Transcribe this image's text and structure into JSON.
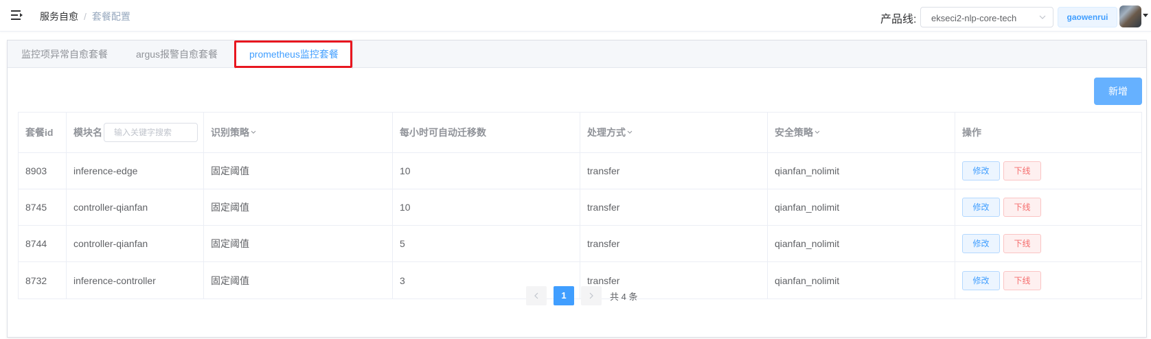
{
  "header": {
    "breadcrumb": {
      "home": "服务自愈",
      "separator": "/",
      "current": "套餐配置"
    },
    "product_line_label": "产品线:",
    "product_line_value": "ekseci2-nlp-core-tech",
    "username": "gaowenrui"
  },
  "tabs": [
    {
      "label": "监控项异常自愈套餐",
      "active": false
    },
    {
      "label": "argus报警自愈套餐",
      "active": false
    },
    {
      "label": "prometheus监控套餐",
      "active": true
    }
  ],
  "add_button": "新增",
  "table": {
    "columns": [
      "套餐id",
      "模块名",
      "识别策略",
      "每小时可自动迁移数",
      "处理方式",
      "安全策略",
      "操作"
    ],
    "module_search_placeholder": "输入关键字搜索",
    "rows": [
      {
        "id": "8903",
        "module": "inference-edge",
        "strategy": "固定阈值",
        "migrations": "10",
        "handling": "transfer",
        "security": "qianfan_nolimit"
      },
      {
        "id": "8745",
        "module": "controller-qianfan",
        "strategy": "固定阈值",
        "migrations": "10",
        "handling": "transfer",
        "security": "qianfan_nolimit"
      },
      {
        "id": "8744",
        "module": "controller-qianfan",
        "strategy": "固定阈值",
        "migrations": "5",
        "handling": "transfer",
        "security": "qianfan_nolimit"
      },
      {
        "id": "8732",
        "module": "inference-controller",
        "strategy": "固定阈值",
        "migrations": "3",
        "handling": "transfer",
        "security": "qianfan_nolimit"
      }
    ],
    "actions": {
      "edit": "修改",
      "offline": "下线"
    }
  },
  "pagination": {
    "current_page": "1",
    "total_text": "共 4 条"
  },
  "colors": {
    "accent": "#409eff",
    "danger": "#f56c6c",
    "highlight_border": "#e8161f"
  },
  "icons": {
    "menu": "menu-fold-icon",
    "select": "chevron-down-icon",
    "avatar_caret": "caret-down-icon",
    "sort": "caret-down-icon",
    "prev": "chevron-left-icon",
    "next": "chevron-right-icon"
  }
}
